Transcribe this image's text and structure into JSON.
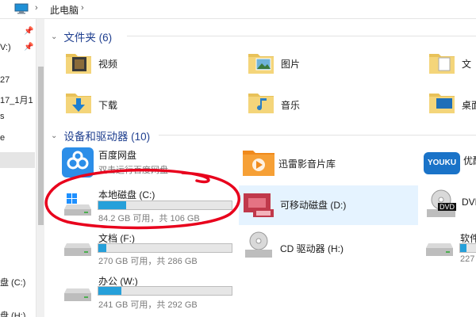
{
  "breadcrumb": {
    "sep1": "›",
    "current": "此电脑",
    "sep2": "›"
  },
  "nav": {
    "items": [
      {
        "label": "V:)"
      },
      {
        "label": "27"
      },
      {
        "label": "17_1月1"
      },
      {
        "label": "s"
      },
      {
        "label": "e"
      },
      {
        "label": "盘 (C:)"
      },
      {
        "label": "盘 (H:)"
      }
    ]
  },
  "folders_section": {
    "title": "文件夹 (6)"
  },
  "folders": [
    {
      "label": "视频",
      "icon": "video-folder-icon"
    },
    {
      "label": "图片",
      "icon": "pictures-folder-icon"
    },
    {
      "label": "文",
      "icon": "documents-folder-icon"
    },
    {
      "label": "下载",
      "icon": "downloads-folder-icon"
    },
    {
      "label": "音乐",
      "icon": "music-folder-icon"
    },
    {
      "label": "桌面",
      "icon": "desktop-folder-icon"
    }
  ],
  "devices_section": {
    "title": "设备和驱动器 (10)"
  },
  "devices": {
    "baidu": {
      "label": "百度网盘",
      "sub": "双击运行百度网盘"
    },
    "xunlei": {
      "label": "迅雷影音片库"
    },
    "youku": {
      "label": "优酷",
      "logo": "YOUKU"
    },
    "c_drive": {
      "label": "本地磁盘 (C:)",
      "sub": "84.2 GB 可用，共 106 GB",
      "used_fraction": 0.21
    },
    "d_drive": {
      "label": "可移动磁盘 (D:)"
    },
    "dvd": {
      "label": "DVD",
      "logo": "DVD"
    },
    "f_drive": {
      "label": "文档 (F:)",
      "sub": "270 GB 可用，共 286 GB",
      "used_fraction": 0.06
    },
    "h_drive": {
      "label": "CD 驱动器 (H:)"
    },
    "soft": {
      "label": "软件",
      "sub": "227"
    },
    "w_drive": {
      "label": "办公 (W:)",
      "sub": "241 GB 可用，共 292 GB",
      "used_fraction": 0.17
    }
  },
  "colors": {
    "accent": "#26a0da",
    "selection": "#cce8ff",
    "annotation": "#e8001c",
    "header": "#1f3f8f"
  }
}
